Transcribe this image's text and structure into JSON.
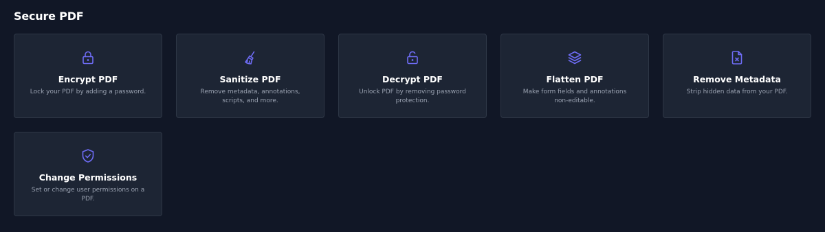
{
  "section": {
    "title": "Secure PDF"
  },
  "colors": {
    "background": "#111726",
    "card": "#1d2534",
    "card_border": "#2e3746",
    "accent": "#6e6cf5",
    "title": "#ffffff",
    "description": "#9aa2b1"
  },
  "tools": [
    {
      "icon": "lock-icon",
      "title": "Encrypt PDF",
      "description": "Lock your PDF by adding a password."
    },
    {
      "icon": "broom-icon",
      "title": "Sanitize PDF",
      "description": "Remove metadata, annotations, scripts, and more."
    },
    {
      "icon": "unlock-icon",
      "title": "Decrypt PDF",
      "description": "Unlock PDF by removing password protection."
    },
    {
      "icon": "layers-icon",
      "title": "Flatten PDF",
      "description": "Make form fields and annotations non-editable."
    },
    {
      "icon": "file-x-icon",
      "title": "Remove Metadata",
      "description": "Strip hidden data from your PDF."
    },
    {
      "icon": "shield-check-icon",
      "title": "Change Permissions",
      "description": "Set or change user permissions on a PDF."
    }
  ]
}
